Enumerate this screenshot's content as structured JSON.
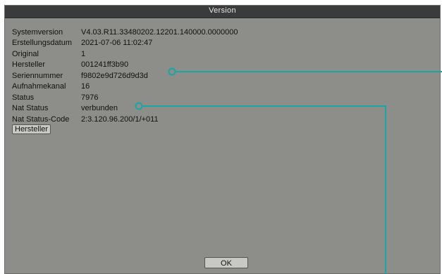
{
  "window": {
    "title": "Version"
  },
  "info_rows": [
    {
      "label": "Systemversion",
      "value": "V4.03.R11.33480202.12201.140000.0000000"
    },
    {
      "label": "Erstellungsdatum",
      "value": "2021-07-06 11:02:47"
    },
    {
      "label": "Original",
      "value": "1"
    },
    {
      "label": "Hersteller",
      "value": "001241ff3b90"
    },
    {
      "label": "Seriennummer",
      "value": "f9802e9d726d9d3d"
    },
    {
      "label": "Aufnahmekanal",
      "value": "16"
    },
    {
      "label": "Status",
      "value": "7976"
    },
    {
      "label": "Nat Status",
      "value": "verbunden"
    },
    {
      "label": "Nat Status-Code",
      "value": "2:3.120.96.200/1/+011"
    }
  ],
  "buttons": {
    "hersteller": "Hersteller",
    "ok": "OK"
  },
  "colors": {
    "dialog_background": "#8d8d8a",
    "title_bar": "#3a3b3d",
    "callout_line": "#1aa6a6"
  }
}
